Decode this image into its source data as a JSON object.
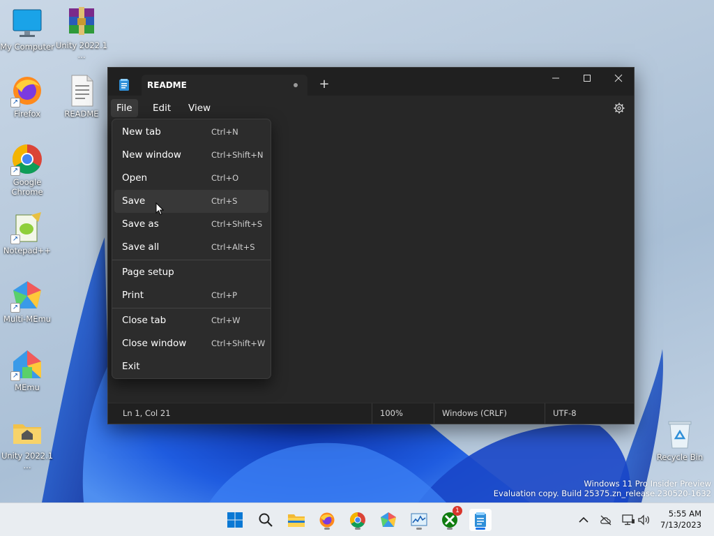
{
  "desktop": {
    "icons": [
      {
        "label": "My Computer"
      },
      {
        "label": "Unity 2022.1 ..."
      },
      {
        "label": "Firefox"
      },
      {
        "label": "README"
      },
      {
        "label": "Google Chrome"
      },
      {
        "label": "Notepad++"
      },
      {
        "label": "Multi-MEmu"
      },
      {
        "label": "MEmu"
      },
      {
        "label": "Unity 2022.1 ..."
      },
      {
        "label": "Recycle Bin"
      }
    ],
    "watermark": {
      "line1": "Windows 11 Pro Insider Preview",
      "line2": "Evaluation copy. Build 25375.zn_release.230520-1632"
    }
  },
  "notepad": {
    "tab_title": "README",
    "new_tab_symbol": "+",
    "menu": {
      "file": "File",
      "edit": "Edit",
      "view": "View"
    },
    "file_menu": [
      {
        "label": "New tab",
        "shortcut": "Ctrl+N"
      },
      {
        "label": "New window",
        "shortcut": "Ctrl+Shift+N"
      },
      {
        "label": "Open",
        "shortcut": "Ctrl+O"
      },
      {
        "label": "Save",
        "shortcut": "Ctrl+S"
      },
      {
        "label": "Save as",
        "shortcut": "Ctrl+Shift+S"
      },
      {
        "label": "Save all",
        "shortcut": "Ctrl+Alt+S"
      },
      {
        "label": "Page setup",
        "shortcut": ""
      },
      {
        "label": "Print",
        "shortcut": "Ctrl+P"
      },
      {
        "label": "Close tab",
        "shortcut": "Ctrl+W"
      },
      {
        "label": "Close window",
        "shortcut": "Ctrl+Shift+W"
      },
      {
        "label": "Exit",
        "shortcut": ""
      }
    ],
    "status": {
      "position": "Ln 1, Col 21",
      "zoom": "100%",
      "line_ending": "Windows (CRLF)",
      "encoding": "UTF-8"
    }
  },
  "taskbar": {
    "xbox_badge": "1",
    "clock": {
      "time": "5:55 AM",
      "date": "7/13/2023"
    }
  },
  "colors": {
    "window_bg": "#272727",
    "titlebar_bg": "#202020",
    "menu_bg": "#2c2c2c",
    "accent": "#1a73e8"
  }
}
